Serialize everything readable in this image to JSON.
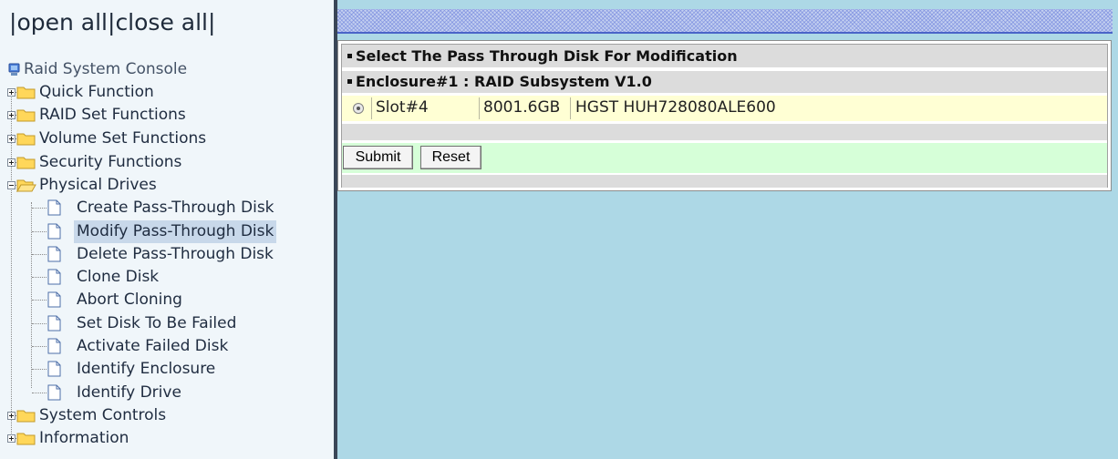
{
  "nav": {
    "open_all": "open all",
    "close_all": "close all",
    "root": "Raid System Console",
    "items": [
      {
        "label": "Quick Function"
      },
      {
        "label": "RAID Set Functions"
      },
      {
        "label": "Volume Set Functions"
      },
      {
        "label": "Security Functions"
      },
      {
        "label": "Physical Drives"
      },
      {
        "label": "System Controls"
      },
      {
        "label": "Information"
      }
    ],
    "physical_children": [
      {
        "label": "Create Pass-Through Disk"
      },
      {
        "label": "Modify Pass-Through Disk"
      },
      {
        "label": "Delete Pass-Through Disk"
      },
      {
        "label": "Clone Disk"
      },
      {
        "label": "Abort Cloning"
      },
      {
        "label": "Set Disk To Be Failed"
      },
      {
        "label": "Activate Failed Disk"
      },
      {
        "label": "Identify Enclosure"
      },
      {
        "label": "Identify Drive"
      }
    ]
  },
  "main": {
    "section_title": "Select The Pass Through Disk For Modification",
    "enclosure_title": "Enclosure#1 : RAID Subsystem V1.0",
    "drives": [
      {
        "slot": "Slot#4",
        "capacity": "8001.6GB",
        "model": "HGST HUH728080ALE600",
        "selected": true
      }
    ],
    "submit_label": "Submit",
    "reset_label": "Reset"
  },
  "colors": {
    "main_background": "#add8e6",
    "nav_background": "#f0f6fa",
    "drive_row": "#ffffd4",
    "button_bar": "#d6ffd8",
    "selected_item": "#c8d8ea"
  }
}
